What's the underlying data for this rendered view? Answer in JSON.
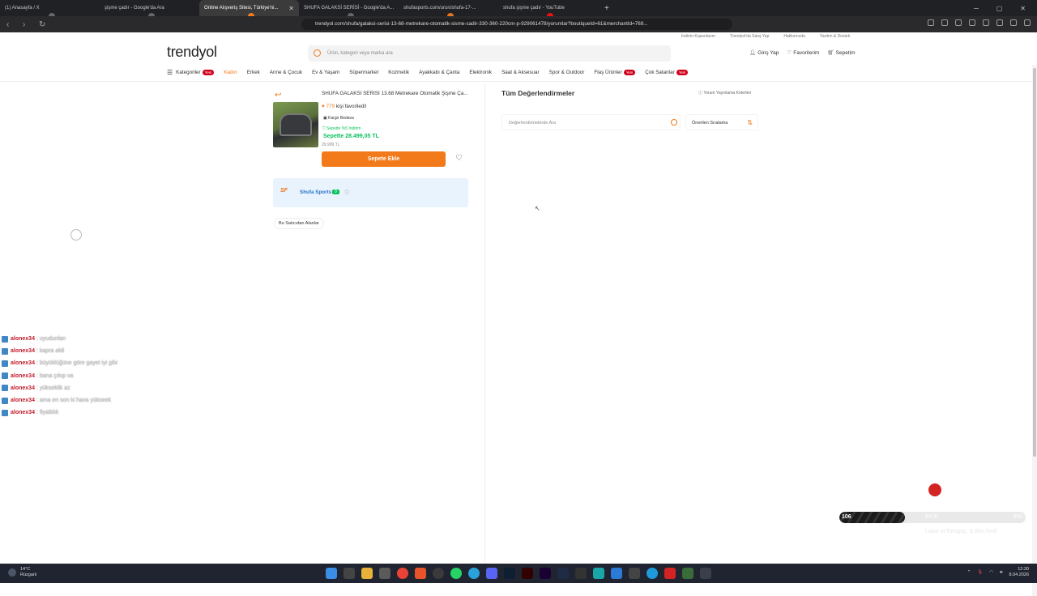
{
  "browser": {
    "tabs": [
      {
        "label": "(1) Anasayfa / X",
        "active": false
      },
      {
        "label": "şişme çadır - Google'da Ara",
        "active": false
      },
      {
        "label": "Online Alışveriş Sitesi, Türkiye'ni...",
        "active": true
      },
      {
        "label": "SHUFA GALAKSİ SERİSİ - Google'da A...",
        "active": false
      },
      {
        "label": "shufasports.com/urun/shufa-17-...",
        "active": false
      },
      {
        "label": "shufa şişme çadır - YouTube",
        "active": false
      }
    ],
    "new_tab": "+",
    "url": "trendyol.com/shufa/galaksi-serisi-13-68-metrekare-otomatik-sisme-cadir-330-360-220cm-p-929061478/yorumlar?boutiqueId=61&merchantId=769..."
  },
  "site": {
    "top_links": [
      "İndirim Kuponlarım",
      "Trendyol'da Satış Yap",
      "Hakkımızda",
      "Yardım & Destek"
    ],
    "logo": "trendyol",
    "search_placeholder": "Ürün, kategori veya marka ara",
    "user_links": {
      "login": "Giriş Yap",
      "favorites": "Favorilerim",
      "cart": "Sepetim"
    },
    "categories_label": "Kategoriler",
    "new_badge": "Yeni",
    "nav": [
      "Kadın",
      "Erkek",
      "Anne & Çocuk",
      "Ev & Yaşam",
      "Süpermarket",
      "Kozmetik",
      "Ayakkabı & Çanta",
      "Elektronik",
      "Saat & Aksesuar",
      "Spor & Outdoor"
    ],
    "flash": "Flaş Ürünler",
    "bestsellers": "Çok Satanlar"
  },
  "product": {
    "title": "SHUFA GALAKSİ SERİSİ 13.68 Metrekare Otomatik Şişme Ça...",
    "fav_count": "779",
    "fav_text": "kişi favoriledi!",
    "cargo": "Kargo Bedava",
    "campaign": "Sepette %5 İndirim",
    "cart_price": "Sepette 28.499,05 TL",
    "old_price": "29.999 TL",
    "add_to_cart": "Sepete Ekle"
  },
  "seller": {
    "name": "Shufa Sports",
    "score": "9",
    "others_button": "Bu Satıcıdan Alanlar"
  },
  "reviews": {
    "title": "Tüm Değerlendirmeler",
    "criteria": "Yorum Yayınlama Kriterleri",
    "search_placeholder": "Değerlendirmelerde Ara",
    "sort": "Önerilen Sıralama"
  },
  "chat": [
    {
      "user": "alonex34",
      "msg": "uyudunlan"
    },
    {
      "user": "alonex34",
      "msg": "kapra aldi"
    },
    {
      "user": "alonex34",
      "msg": "büyüklüğüne göre gayet iyi gibi"
    },
    {
      "user": "alonex34",
      "msg": "bana çıkıp va"
    },
    {
      "user": "alonex34",
      "msg": "yükseklik az"
    },
    {
      "user": "alonex34",
      "msg": "ama en son ki hava yükseek"
    },
    {
      "user": "alonex34",
      "msg": "fiyatlılık"
    }
  ],
  "overlay": {
    "current": "106",
    "label": "EKIP",
    "max": "300",
    "progress": 0.35,
    "subtitle": "Lawe ut Rengaç. Ş Abn hmtl"
  },
  "taskbar": {
    "temp": "14°C",
    "weather": "Rüzgarlı",
    "time": "12:30",
    "date": "8.04.2026"
  }
}
